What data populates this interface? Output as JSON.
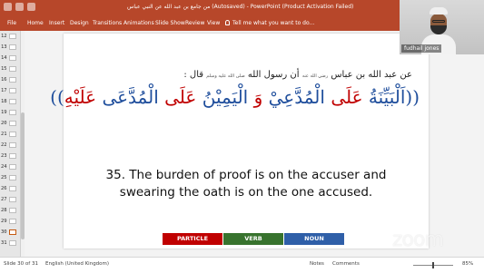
{
  "window": {
    "title": "من جامع بن عبد الله عن النبي عباس (Autosaved) - PowerPoint (Product Activation Failed)",
    "accent": "#b7472a"
  },
  "ribbon": {
    "tabs": [
      "File",
      "Home",
      "Insert",
      "Design",
      "Transitions",
      "Animations",
      "Slide Show",
      "Review",
      "View"
    ],
    "tell_me": "Tell me what you want to do..."
  },
  "thumbnails": {
    "numbers": [
      "12",
      "13",
      "14",
      "15",
      "16",
      "17",
      "18",
      "19",
      "20",
      "21",
      "22",
      "23",
      "24",
      "25",
      "26",
      "27",
      "28",
      "29",
      "30",
      "31"
    ],
    "active": "30"
  },
  "slide": {
    "arabic_intro": "عن عبد الله بن عباس",
    "arabic_honorific_1": "رضي الله عنه",
    "arabic_intro_2": "أن رسول الله",
    "arabic_honorific_2": "صلى الله عليه وسلم",
    "arabic_intro_3": "قال :",
    "hadith_open": "((",
    "hadith_words": [
      {
        "text": "اَلْبَيِّنَةُ",
        "kind": "noun"
      },
      {
        "text": "عَلَى",
        "kind": "particle"
      },
      {
        "text": "الْمُدَّعِيْ",
        "kind": "noun"
      },
      {
        "text": "وَ",
        "kind": "particle"
      },
      {
        "text": "الْيَمِيْنُ",
        "kind": "noun"
      },
      {
        "text": "عَلَى",
        "kind": "particle"
      },
      {
        "text": "الْمُدَّعَى",
        "kind": "noun"
      },
      {
        "text": "عَلَيْهِ",
        "kind": "particle"
      }
    ],
    "hadith_close": "))",
    "english_line1": "35. The burden of proof is on the accuser and",
    "english_line2": "swearing the oath is on the one accused.",
    "legend": {
      "particle": "PARTICLE",
      "verb": "VERB",
      "noun": "NOUN"
    },
    "colors": {
      "particle": "#c00000",
      "verb": "#38732e",
      "noun": "#2f5fa8"
    }
  },
  "video": {
    "participant_name": "fudhail jones"
  },
  "watermark": "zoom",
  "status": {
    "slide_info": "Slide 30 of 31",
    "language": "English (United Kingdom)",
    "notes": "Notes",
    "comments": "Comments",
    "zoom_level": "85%"
  }
}
